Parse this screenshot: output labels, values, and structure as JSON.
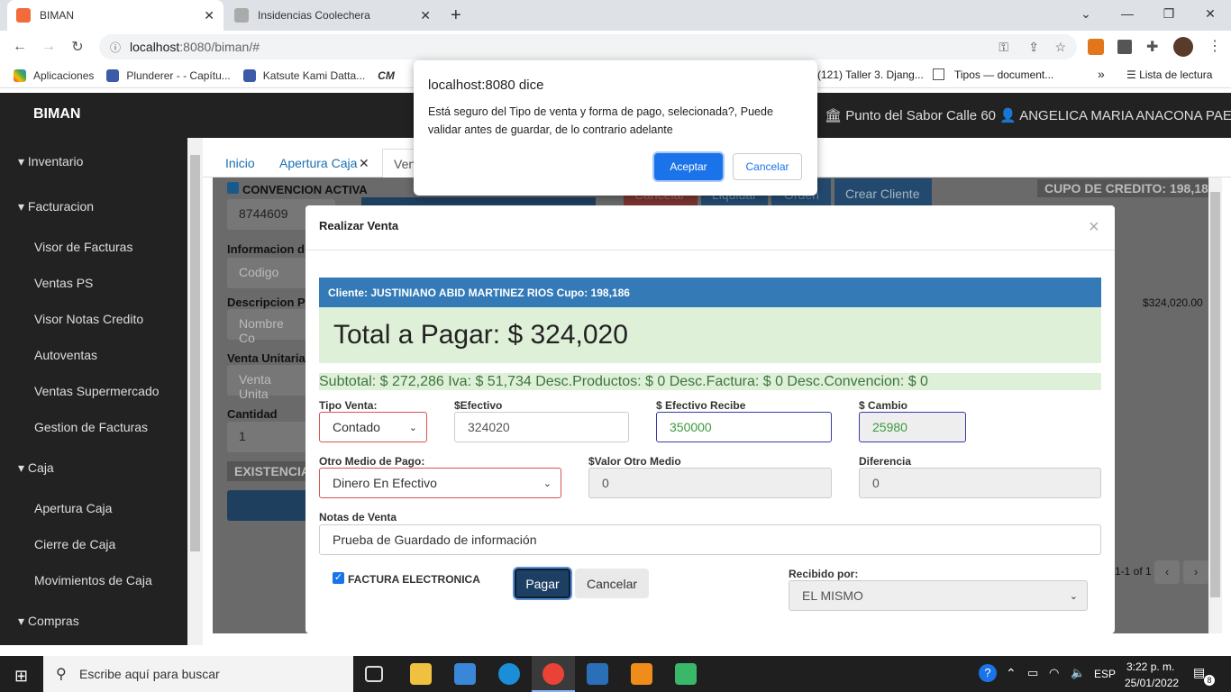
{
  "browser": {
    "tabs": [
      {
        "label": "BIMAN",
        "active": true
      },
      {
        "label": "Insidencias Coolechera",
        "active": false
      }
    ],
    "url_host": "localhost",
    "url_rest": ":8080/biman/#",
    "bookmarks": [
      "Aplicaciones",
      "Plunderer - - Capítu...",
      "Katsute Kami Datta...",
      "(121) Taller 3. Djang...",
      "Tipos — document..."
    ],
    "reading_list": "Lista de lectura"
  },
  "app": {
    "brand": "BIMAN",
    "user_info": "Punto del Sabor Calle 60 ",
    "user_name": "ANGELICA MARIA ANACONA PAEZ"
  },
  "sidebar": {
    "groups": [
      {
        "label": "Inventario",
        "items": []
      },
      {
        "label": "Facturacion",
        "items": [
          "Visor de Facturas",
          "Ventas PS",
          "Visor Notas Credito",
          "Autoventas",
          "Ventas Supermercado",
          "Gestion de Facturas"
        ]
      },
      {
        "label": "Caja",
        "items": [
          "Apertura Caja",
          "Cierre de Caja",
          "Movimientos de Caja"
        ]
      },
      {
        "label": "Compras",
        "items": []
      }
    ]
  },
  "page_tabs": [
    "Inicio",
    "Apertura Caja",
    "Ven"
  ],
  "background": {
    "convencion": "CONVENCION ACTIVA",
    "convencion_value": "8744609",
    "info_label": "Informacion d",
    "codigo_placeholder": "Codigo",
    "desc_label": "Descripcion Pr",
    "nombre_placeholder": "Nombre Co",
    "venta_label": "Venta Unitaria",
    "venta_placeholder": "Venta Unita",
    "cantidad_label": "Cantidad",
    "cantidad_value": "1",
    "existencia": "EXISTENCIA",
    "cancelar": "Cancelar",
    "liquidar": "Liquidar",
    "orden": "Orden",
    "crear_cliente": "Crear Cliente",
    "cupo": "CUPO DE CREDITO: 198,18",
    "amount": "$324,020.00",
    "pagination": "1-1 of 1"
  },
  "modal": {
    "title": "Realizar Venta",
    "client": "Cliente: JUSTINIANO ABID MARTINEZ RIOS Cupo: 198,186",
    "total": "Total a Pagar: $ 324,020",
    "subtotal": "Subtotal: $ 272,286 Iva: $ 51,734 Desc.Productos: $ 0 Desc.Factura: $ 0 Desc.Convencion: $ 0",
    "tipo_venta_label": "Tipo Venta:",
    "tipo_venta_value": "Contado",
    "efectivo_label": "$Efectivo",
    "efectivo_value": "324020",
    "efectivo_recibe_label": "$ Efectivo Recibe",
    "efectivo_recibe_value": "350000",
    "cambio_label": "$ Cambio",
    "cambio_value": "25980",
    "otro_medio_label": "Otro Medio de Pago:",
    "otro_medio_value": "Dinero En Efectivo",
    "valor_otro_label": "$Valor Otro Medio",
    "valor_otro_value": "0",
    "diferencia_label": "Diferencia",
    "diferencia_value": "0",
    "notas_label": "Notas de Venta",
    "notas_value": "Prueba de Guardado de información",
    "factura_electronica": "FACTURA ELECTRONICA",
    "pagar": "Pagar",
    "cancelar": "Cancelar",
    "recibido_label": "Recibido por:",
    "recibido_value": "EL MISMO"
  },
  "alert": {
    "title": "localhost:8080 dice",
    "message": "Está seguro del Tipo de venta y forma de pago, selecionada?, Puede validar antes de guardar, de lo contrario adelante",
    "accept": "Aceptar",
    "cancel": "Cancelar"
  },
  "taskbar": {
    "search_placeholder": "Escribe aquí para buscar",
    "lang": "ESP",
    "time": "3:22 p. m.",
    "date": "25/01/2022",
    "notifications": "8"
  },
  "colors": {
    "primary": "#337ab7",
    "header": "#222222",
    "success_bg": "#dff0d8",
    "danger": "#d9534f"
  }
}
